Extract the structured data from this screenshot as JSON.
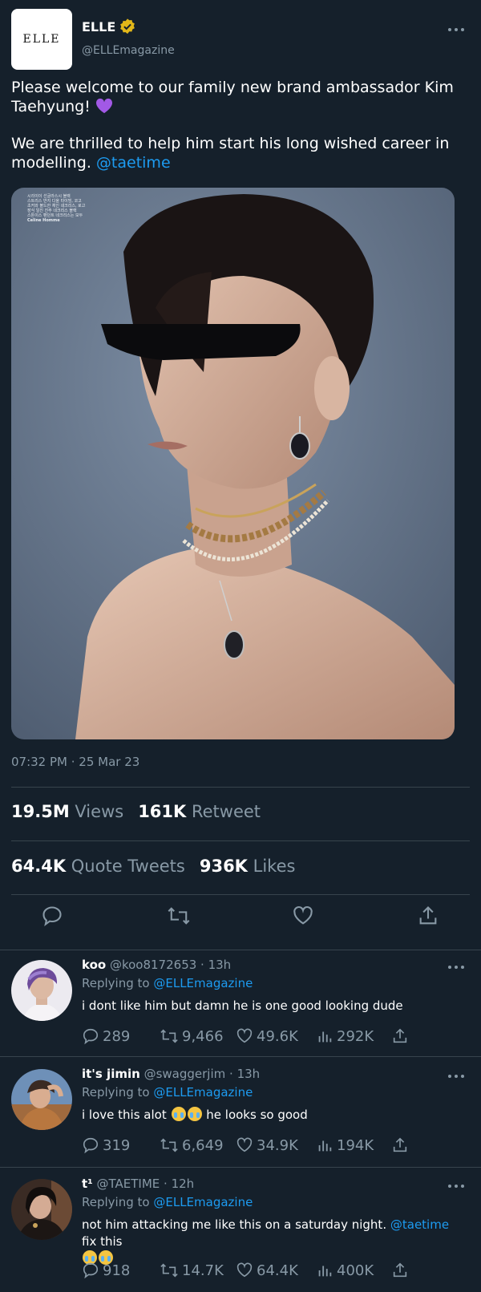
{
  "tweet": {
    "name": "ELLE",
    "handle": "@ELLEmagazine",
    "avatar_text": "ELLE",
    "line1": "Please welcome to our family new brand ambassador Kim Taehyung!",
    "line2": "We are thrilled to help him start his long wished career in modelling.",
    "mention": "@taetime",
    "time": "07:32 PM",
    "date": "25 Mar 23",
    "views_value": "19.5M",
    "views_label": "Views",
    "retweets_value": "161K",
    "retweets_label": "Retweet",
    "quotes_value": "64.4K",
    "quotes_label": "Quote Tweets",
    "likes_value": "936K",
    "likes_label": "Likes",
    "photo_caption_lines": [
      "시리이이 선글라스시 블랙",
      "스트리스 반지 디올 타이빙, 코고",
      "초커와 볼드한 체인 네크리스, 로고",
      "장식 일진 진주 네크리스 블랙",
      "스톤이스 팬던트 네크리스는 모두",
      "Celine Homme"
    ]
  },
  "replies": [
    {
      "name": "koo",
      "handle": "@koo8172653",
      "time": "13h",
      "replying_label": "Replying to",
      "replying_to": "@ELLEmagazine",
      "text": "i dont like him but damn he is one good looking dude",
      "replies": "289",
      "retweets": "9,466",
      "likes": "49.6K",
      "views": "292K"
    },
    {
      "name": "it's jimin",
      "handle": "@swaggerjim",
      "time": "13h",
      "replying_label": "Replying to",
      "replying_to": "@ELLEmagazine",
      "text_before": "i love this alot",
      "text_after": "he looks so good",
      "replies": "319",
      "retweets": "6,649",
      "likes": "34.9K",
      "views": "194K"
    },
    {
      "name": "t¹",
      "handle": "@TAETIME",
      "time": "12h",
      "replying_label": "Replying to",
      "replying_to": "@ELLEmagazine",
      "text_before": "not him attacking me like this on a saturday night.",
      "mention": "@taetime",
      "text_after": "fix this",
      "replies": "918",
      "retweets": "14.7K",
      "likes": "64.4K",
      "views": "400K"
    }
  ],
  "colors": {
    "background": "#15202b",
    "link": "#1d9bf0",
    "muted": "#8899a6",
    "verified": "#e2b719",
    "like_emoji": "#a259e6"
  }
}
